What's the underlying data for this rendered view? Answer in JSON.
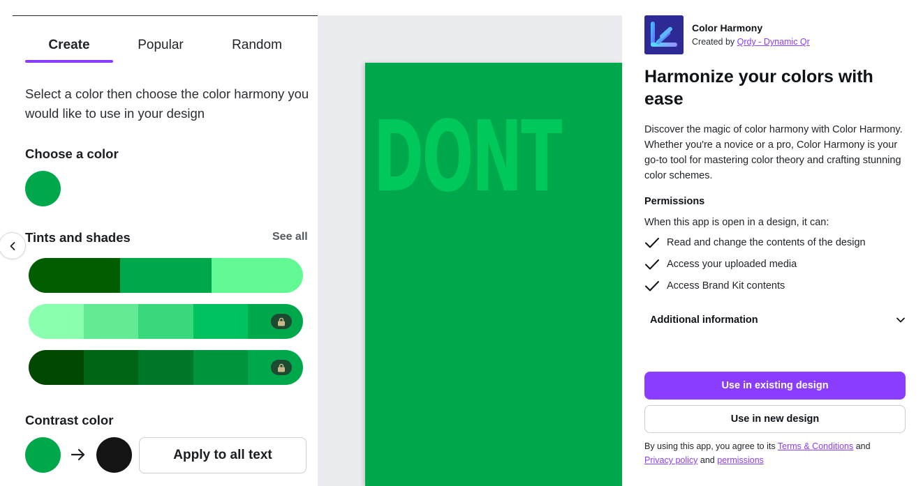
{
  "left_panel": {
    "tabs": [
      {
        "label": "Create",
        "active": true
      },
      {
        "label": "Popular",
        "active": false
      },
      {
        "label": "Random",
        "active": false
      }
    ],
    "intro": "Select a color then choose the color harmony you would like to use in your design",
    "choose_color": {
      "heading": "Choose a color",
      "selected_color": "#00a84c"
    },
    "tints": {
      "heading": "Tints and shades",
      "see_all_label": "See all",
      "palettes": [
        {
          "colors": [
            "#005e00",
            "#00a84c",
            "#62f994"
          ],
          "locked": false
        },
        {
          "colors": [
            "#8affaf",
            "#62ea94",
            "#3ad77c",
            "#00c35f",
            "#00a84c"
          ],
          "locked": true
        },
        {
          "colors": [
            "#004700",
            "#006514",
            "#00782a",
            "#00953c",
            "#00a84c"
          ],
          "locked": true
        }
      ]
    },
    "contrast": {
      "heading": "Contrast color",
      "from_color": "#00a84c",
      "to_color": "#141414",
      "apply_label": "Apply to all text"
    }
  },
  "canvas": {
    "page_color": "#00a84c",
    "text": "DONT",
    "text_color": "#00c85a"
  },
  "right_panel": {
    "app_name": "Color Harmony",
    "created_by_prefix": "Created by",
    "creator": "Qrdy - Dynamic Qr",
    "headline": "Harmonize your colors with ease",
    "description": "Discover the magic of color harmony with Color Harmony. Whether you're a novice or a pro, Color Harmony is your go-to tool for mastering color theory and crafting stunning color schemes.",
    "permissions_title": "Permissions",
    "permissions_intro": "When this app is open in a design, it can:",
    "permissions": [
      "Read and change the contents of the design",
      "Access your uploaded media",
      "Access Brand Kit contents"
    ],
    "additional_info_label": "Additional information",
    "use_existing_label": "Use in existing design",
    "use_new_label": "Use in new design",
    "terms": {
      "prefix": "By using this app, you agree to its",
      "terms_link": "Terms & Conditions",
      "and1": "and",
      "privacy_link": "Privacy policy",
      "and2": "and",
      "permissions_link": "permissions"
    },
    "accent_color": "#8b3dff"
  }
}
